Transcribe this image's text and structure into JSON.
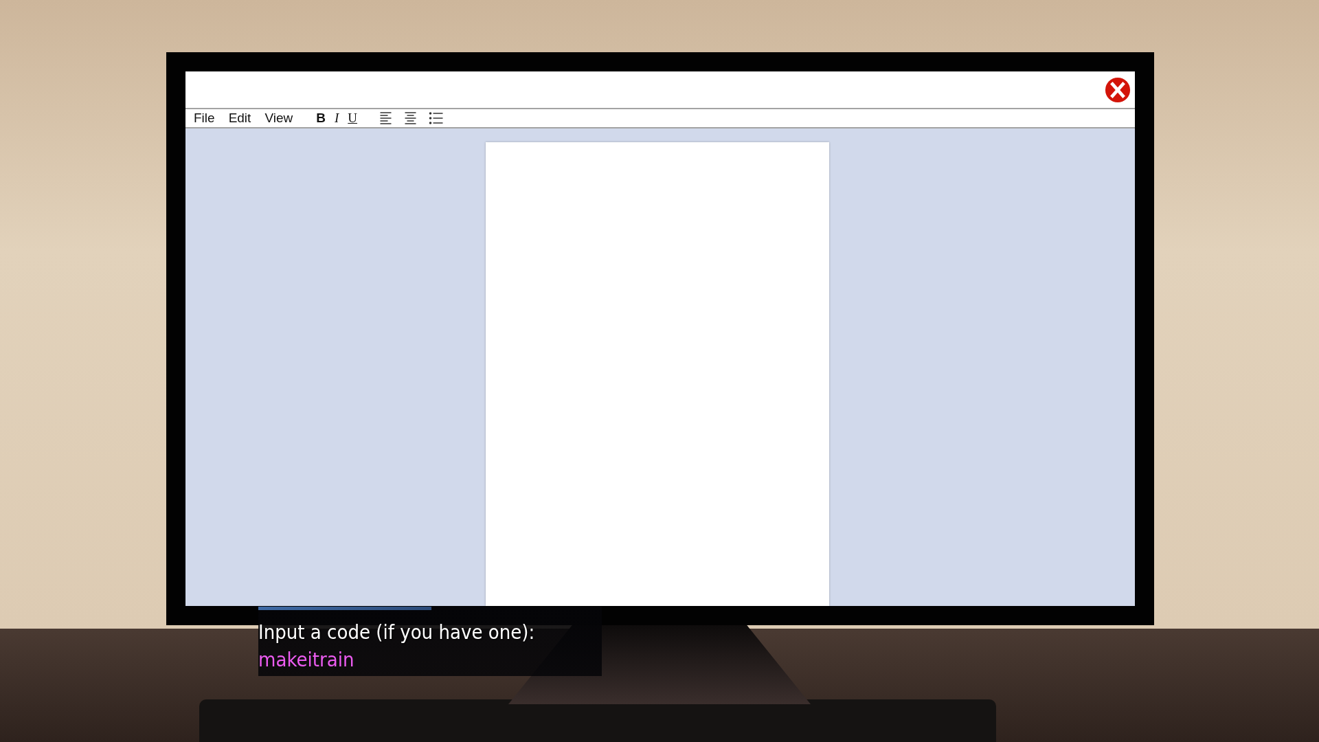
{
  "menu": [
    {
      "label": "File"
    },
    {
      "label": "Edit"
    },
    {
      "label": "View"
    }
  ],
  "format_buttons": [
    {
      "label": "B",
      "kind": "bold"
    },
    {
      "label": "I",
      "kind": "italic"
    },
    {
      "label": "U",
      "kind": "underline"
    }
  ],
  "tool_icons": [
    {
      "kind": "align-left"
    },
    {
      "kind": "align-center"
    },
    {
      "kind": "list"
    }
  ],
  "code_prompt": {
    "prompt": "Input a code (if you have one):",
    "value": "makeitrain"
  }
}
